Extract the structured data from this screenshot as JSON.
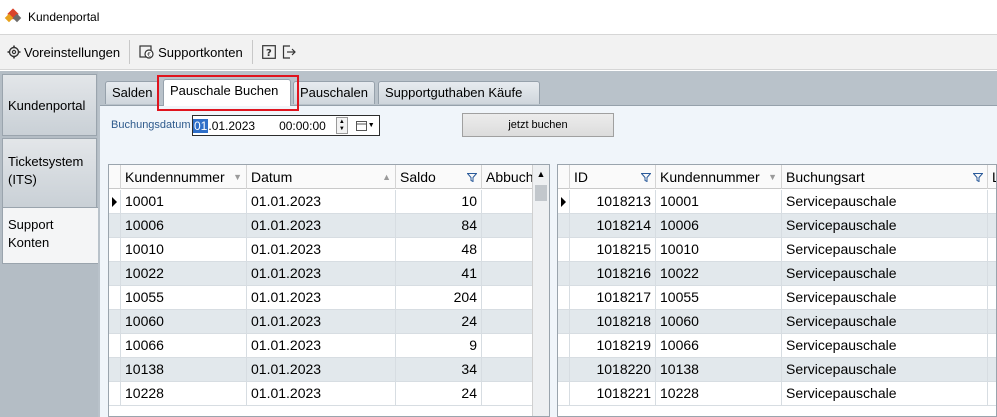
{
  "window": {
    "title": "Kundenportal"
  },
  "toolbar": {
    "settings_label": "Voreinstellungen",
    "supportaccounts_label": "Supportkonten"
  },
  "nav": {
    "items": [
      {
        "label": "Kundenportal"
      },
      {
        "label": "Ticketsystem (ITS)"
      },
      {
        "label": "Support Konten"
      }
    ]
  },
  "tabs": [
    {
      "label": "Salden"
    },
    {
      "label": "Pauschale Buchen"
    },
    {
      "label": "Pauschalen"
    },
    {
      "label": "Supportguthaben Käufe"
    }
  ],
  "form": {
    "date_label": "Buchungsdatum",
    "date_selected": "01",
    "date_rest": ".01.2023",
    "time": "00:00:00",
    "book_button": "jetzt buchen"
  },
  "left_grid": {
    "columns": [
      "Kundennummer",
      "Datum",
      "Saldo",
      "Abbuch"
    ],
    "rows": [
      [
        "10001",
        "01.01.2023",
        "10",
        ""
      ],
      [
        "10006",
        "01.01.2023",
        "84",
        ""
      ],
      [
        "10010",
        "01.01.2023",
        "48",
        ""
      ],
      [
        "10022",
        "01.01.2023",
        "41",
        ""
      ],
      [
        "10055",
        "01.01.2023",
        "204",
        ""
      ],
      [
        "10060",
        "01.01.2023",
        "24",
        ""
      ],
      [
        "10066",
        "01.01.2023",
        "9",
        ""
      ],
      [
        "10138",
        "01.01.2023",
        "34",
        ""
      ],
      [
        "10228",
        "01.01.2023",
        "24",
        ""
      ]
    ]
  },
  "right_grid": {
    "columns": [
      "ID",
      "Kundennummer",
      "Buchungsart",
      "L"
    ],
    "rows": [
      [
        "1018213",
        "10001",
        "Servicepauschale"
      ],
      [
        "1018214",
        "10006",
        "Servicepauschale"
      ],
      [
        "1018215",
        "10010",
        "Servicepauschale"
      ],
      [
        "1018216",
        "10022",
        "Servicepauschale"
      ],
      [
        "1018217",
        "10055",
        "Servicepauschale"
      ],
      [
        "1018218",
        "10060",
        "Servicepauschale"
      ],
      [
        "1018219",
        "10066",
        "Servicepauschale"
      ],
      [
        "1018220",
        "10138",
        "Servicepauschale"
      ],
      [
        "1018221",
        "10228",
        "Servicepauschale"
      ]
    ]
  }
}
